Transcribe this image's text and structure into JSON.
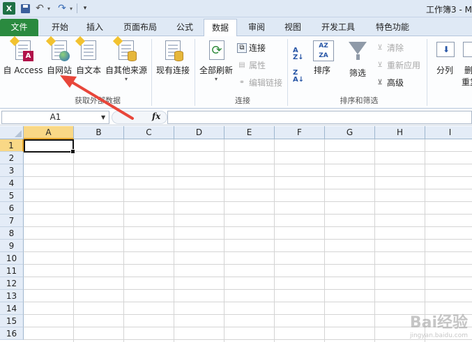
{
  "title_bar": {
    "title": "工作簿3 - M"
  },
  "tabs": [
    {
      "id": "file",
      "label": "文件"
    },
    {
      "id": "home",
      "label": "开始"
    },
    {
      "id": "insert",
      "label": "插入"
    },
    {
      "id": "layout",
      "label": "页面布局"
    },
    {
      "id": "formulas",
      "label": "公式"
    },
    {
      "id": "data",
      "label": "数据"
    },
    {
      "id": "review",
      "label": "审阅"
    },
    {
      "id": "view",
      "label": "视图"
    },
    {
      "id": "developer",
      "label": "开发工具"
    },
    {
      "id": "features",
      "label": "特色功能"
    }
  ],
  "active_tab": "数据",
  "ribbon": {
    "get_external": {
      "from_access": "自 Access",
      "from_web": "自网站",
      "from_text": "自文本",
      "from_other": "自其他来源",
      "existing": "现有连接",
      "group_label": "获取外部数据"
    },
    "connections": {
      "refresh_all": "全部刷新",
      "connections": "连接",
      "properties": "属性",
      "edit_links": "编辑链接",
      "group_label": "连接"
    },
    "sort_filter": {
      "sort": "排序",
      "filter": "筛选",
      "clear": "清除",
      "reapply": "重新应用",
      "advanced": "高级",
      "group_label": "排序和筛选"
    },
    "data_tools": {
      "split": "分列",
      "delete_partial": "删",
      "dup_partial": "重复"
    }
  },
  "formula_bar": {
    "name_box": "A1",
    "fx": "fx",
    "formula": ""
  },
  "grid": {
    "columns": [
      "A",
      "B",
      "C",
      "D",
      "E",
      "F",
      "G",
      "H",
      "I"
    ],
    "rows": [
      "1",
      "2",
      "3",
      "4",
      "5",
      "6",
      "7",
      "8",
      "9",
      "10",
      "11",
      "12",
      "13",
      "14",
      "15",
      "16"
    ],
    "selected_cell": "A1"
  },
  "colors": {
    "file_tab": "#2a8a3f",
    "selection_header": "#f9d886",
    "annotation_arrow": "#e8463a"
  },
  "watermark": {
    "logo": "Bai经验",
    "url": "jingyan.baidu.com"
  }
}
